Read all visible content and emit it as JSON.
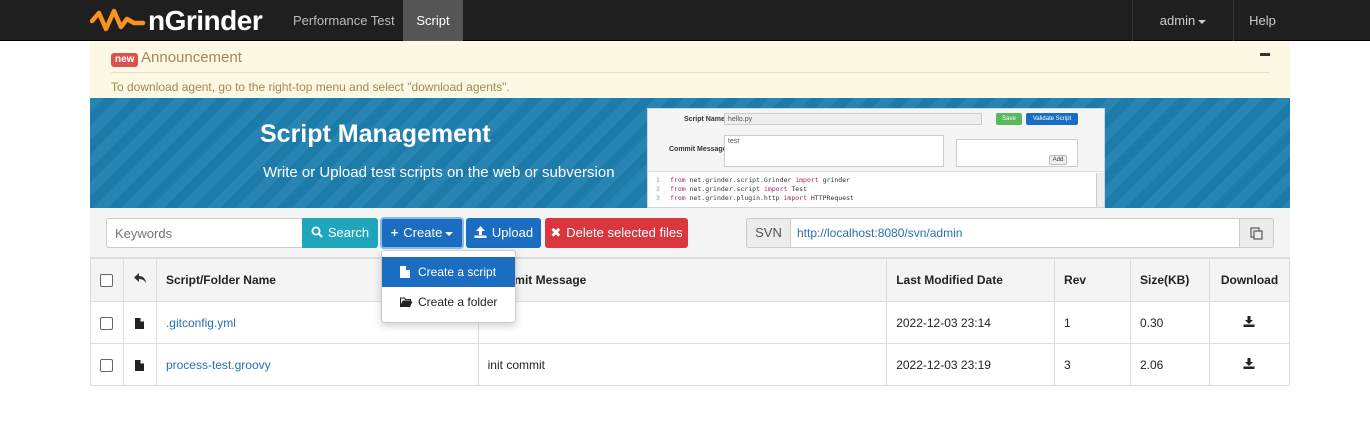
{
  "app": {
    "name": "nGrinder"
  },
  "nav": {
    "items": [
      {
        "label": "Performance Test",
        "active": false
      },
      {
        "label": "Script",
        "active": true
      }
    ],
    "user_label": "admin",
    "help_label": "Help"
  },
  "announcement": {
    "badge": "new",
    "title": "Announcement",
    "text": "To download agent, go to the right-top menu and select \"download agents\"."
  },
  "banner": {
    "title": "Script Management",
    "subtitle": "Write or Upload test scripts on the web or subversion",
    "preview": {
      "script_name_label": "Script Name",
      "script_name_value": "hello.py",
      "save_label": "Save",
      "validate_label": "Validate Script",
      "commit_label": "Commit Message",
      "commit_value": "test",
      "add_label": "Add",
      "code_lines": [
        {
          "num": "1",
          "kw1": "from",
          "mod": " net.grinder.script.Grinder ",
          "kw2": "import",
          "name": " grinder"
        },
        {
          "num": "2",
          "kw1": "from",
          "mod": " net.grinder.script ",
          "kw2": "import",
          "name": " Test"
        },
        {
          "num": "3",
          "kw1": "from",
          "mod": " net.grinder.plugin.http ",
          "kw2": "import",
          "name": " HTTPRequest"
        }
      ]
    }
  },
  "toolbar": {
    "search_placeholder": "Keywords",
    "search_label": "Search",
    "create_label": "Create",
    "upload_label": "Upload",
    "delete_label": "Delete selected files",
    "svn_label": "SVN",
    "svn_url": "http://localhost:8080/svn/admin"
  },
  "create_menu": {
    "items": [
      {
        "label": "Create a script",
        "icon": "file-icon",
        "active": true
      },
      {
        "label": "Create a folder",
        "icon": "folder-open-icon",
        "active": false
      }
    ]
  },
  "table": {
    "headers": {
      "name": "Script/Folder Name",
      "commit": "Commit Message",
      "modified": "Last Modified Date",
      "rev": "Rev",
      "size": "Size(KB)",
      "download": "Download"
    },
    "rows": [
      {
        "name": ".gitconfig.yml",
        "commit": "",
        "modified": "2022-12-03 23:14",
        "rev": "1",
        "size": "0.30"
      },
      {
        "name": "process-test.groovy",
        "commit": "init commit",
        "modified": "2022-12-03 23:19",
        "rev": "3",
        "size": "2.06"
      }
    ]
  },
  "colors": {
    "navbar": "#1f1f1f",
    "primary": "#1a6dc0",
    "info": "#1fa6bd",
    "danger": "#d9363e",
    "banner": "#1e7fb0",
    "link": "#2a6fb0",
    "logo_orange": "#f7931e"
  }
}
